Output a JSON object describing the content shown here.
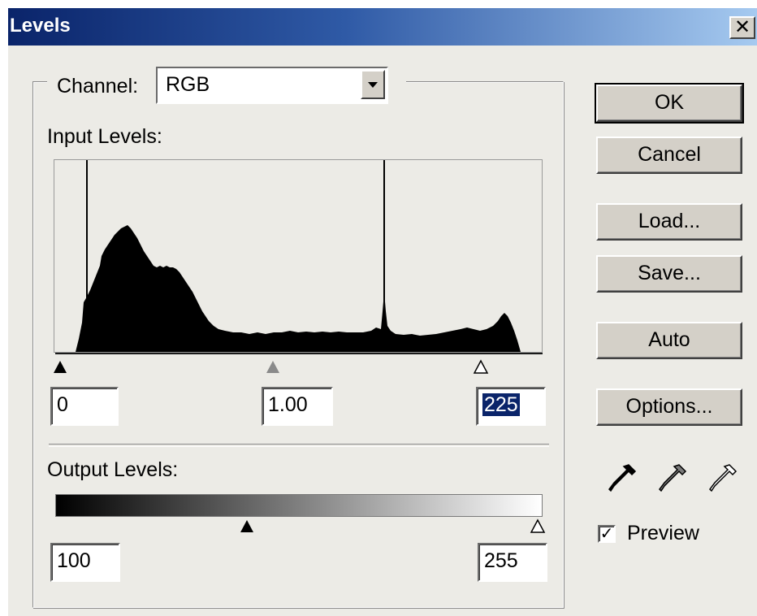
{
  "window": {
    "title": "Levels",
    "close_glyph": "✕"
  },
  "channel": {
    "label": "Channel:",
    "value": "RGB"
  },
  "input_levels": {
    "label": "Input Levels:",
    "black": "0",
    "gamma": "1.00",
    "white": "225"
  },
  "output_levels": {
    "label": "Output Levels:",
    "black": "100",
    "white": "255"
  },
  "buttons": {
    "ok": "OK",
    "cancel": "Cancel",
    "load": "Load...",
    "save": "Save...",
    "auto": "Auto",
    "options": "Options..."
  },
  "preview": {
    "label": "Preview",
    "checked": true,
    "check_glyph": "✓"
  },
  "icons": {
    "eyedroppers": [
      "black-point-eyedropper-icon",
      "gray-point-eyedropper-icon",
      "white-point-eyedropper-icon"
    ],
    "dropdown": "chevron-down-icon"
  },
  "colors": {
    "title_start": "#0a246a",
    "title_end": "#a6caf0",
    "dialog_bg": "#ecebe6",
    "selection": "#0a246a"
  }
}
